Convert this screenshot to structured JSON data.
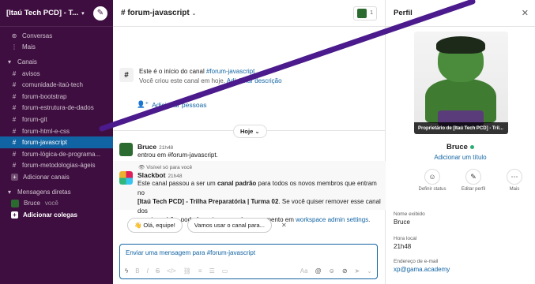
{
  "sidebar": {
    "workspace_name": "[Itaú Tech PCD] - T...",
    "items": [
      {
        "label": "Conversas",
        "icon": "threads-icon"
      },
      {
        "label": "Mais",
        "icon": "more-icon"
      }
    ],
    "channels_header": "Canais",
    "channels": [
      "avisos",
      "comunidade-itaú-tech",
      "forum-bootstrap",
      "forum-estrutura-de-dados",
      "forum-git",
      "forum-html-e-css",
      "forum-javascript",
      "forum-lógica-de-programa...",
      "forum-metodologias-ágeis"
    ],
    "active_channel": "forum-javascript",
    "add_channels": "Adicionar canais",
    "dm_header": "Mensagens diretas",
    "dm_user": "Bruce",
    "dm_you": "você",
    "add_colleagues": "Adicionar colegas"
  },
  "header": {
    "channel_title": "# forum-javascript",
    "member_count": "1"
  },
  "intro": {
    "line1_prefix": "Este é o início do canal ",
    "line1_channel": "#forum-javascript",
    "line2_prefix": "Você criou este canal em hoje. ",
    "line2_link": "Adicionar descrição",
    "add_people": "Adicionar pessoas"
  },
  "day_divider": "Hoje",
  "messages": [
    {
      "author": "Bruce",
      "time": "21h48",
      "text": "entrou em #forum-javascript."
    },
    {
      "note": "Visível só para você",
      "author": "Slackbot",
      "time": "21h48",
      "t1": "Este canal passou a ser um ",
      "t1b": "canal padrão",
      "t1c": " para todos os novos membros que entram no",
      "t2b": "[Itaú Tech PCD] - Trilha Preparatória | Turma 02",
      "t2c": ". Se você quiser remover esse canal dos",
      "t3": "canais padrão, pode fazer isso a qualquer momento em ",
      "t3link": "workspace admin settings",
      "t3end": "."
    }
  ],
  "chips": [
    "👋 Olá, equipe!",
    "Vamos usar o canal para..."
  ],
  "composer": {
    "placeholder": "Enviar uma mensagem para #forum-javascript"
  },
  "panel": {
    "title": "Perfil",
    "photo_caption": "Proprietário de [Itaú Tech PCD] - Tril...",
    "name": "Bruce",
    "add_title": "Adicionar um título",
    "actions": [
      "Definir status",
      "Editar perfil",
      "Mais"
    ],
    "fields": [
      {
        "label": "Nome exibido",
        "value": "Bruce"
      },
      {
        "label": "Hora local",
        "value": "21h48"
      },
      {
        "label": "Endereço de e-mail",
        "value": "xp@gama.academy"
      }
    ]
  },
  "colors": {
    "sidebar": "#3f0e40",
    "active": "#1164a3",
    "link": "#1264a3",
    "overlay": "#4b1a8c"
  }
}
